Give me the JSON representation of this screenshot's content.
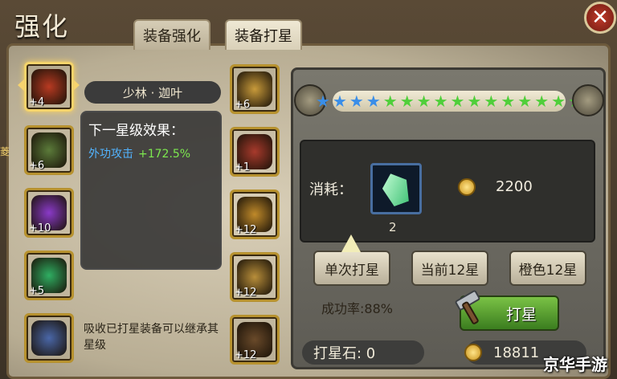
{
  "window": {
    "title": "强化",
    "close_symbol": "✕"
  },
  "tabs": [
    {
      "label": "装备强化"
    },
    {
      "label": "装备打星"
    }
  ],
  "side_label": "菱",
  "left_slots": [
    {
      "level": "+4",
      "color": "#b83a22"
    },
    {
      "level": "+6",
      "color": "#5b7b3a"
    },
    {
      "level": "+10",
      "color": "#8a3ac8"
    },
    {
      "level": "+5",
      "color": "#2fae62"
    },
    {
      "level": "",
      "color": "#4a67a8"
    }
  ],
  "right_slots": [
    {
      "level": "+6",
      "color": "#c89a3a"
    },
    {
      "level": "+1",
      "color": "#a83a2c"
    },
    {
      "level": "+12",
      "color": "#c08a2a"
    },
    {
      "level": "+12",
      "color": "#b88e3a"
    },
    {
      "level": "+12",
      "color": "#6a4a2a"
    }
  ],
  "character": {
    "name": "少林 · 迦叶"
  },
  "next_level": {
    "title": "下一星级效果：",
    "stat": "外功攻击",
    "value": "+172.5%"
  },
  "note": "吸收已打星装备可以继承其星级",
  "stars": {
    "blue": 4,
    "green": 12,
    "blue_color": "#3a8ee8",
    "green_color": "#4fcf3a"
  },
  "cost": {
    "label": "消耗：",
    "stone_count": "2",
    "gold": "2200"
  },
  "buttons": {
    "single": "单次打星",
    "current": "当前12星",
    "orange": "橙色12星",
    "star": "打星"
  },
  "success_rate": "成功率:88%",
  "stone_balance": "打星石:  0",
  "gold_balance": "18811",
  "watermark": "京华手游"
}
